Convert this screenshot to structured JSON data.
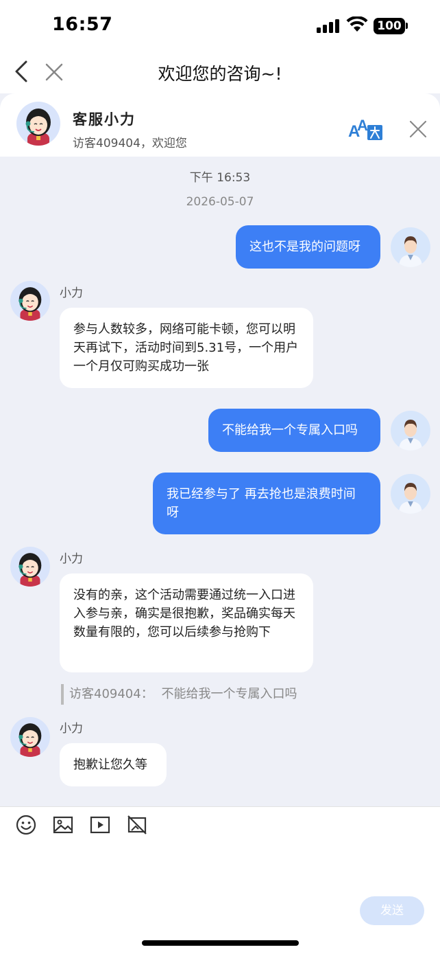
{
  "status_bar": {
    "time": "16:57",
    "battery": "100"
  },
  "nav": {
    "title": "欢迎您的咨询~!"
  },
  "agent": {
    "name": "客服小力",
    "subtitle": "访客409404，欢迎您"
  },
  "chat": {
    "time_label": "下午 16:53",
    "date_label": "2026-05-07",
    "messages": [
      {
        "from": "user",
        "text": "这也不是我的问题呀"
      },
      {
        "from": "agent",
        "sender": "小力",
        "text": "参与人数较多，网络可能卡顿，您可以明天再试下，活动时间到5.31号，一个用户一个月仅可购买成功一张"
      },
      {
        "from": "user",
        "text": "不能给我一个专属入口吗"
      },
      {
        "from": "user",
        "text": "我已经参与了 再去抢也是浪费时间呀"
      },
      {
        "from": "agent",
        "sender": "小力",
        "text": "没有的亲，这个活动需要通过统一入口进入参与亲，确实是很抱歉，奖品确实每天数量有限的，您可以后续参与抢购下"
      },
      {
        "from": "agent",
        "sender": "小力",
        "text": "抱歉让您久等",
        "quote_label": "访客409404：",
        "quote_text": "不能给我一个专属入口吗"
      }
    ]
  },
  "input": {
    "placeholder": "",
    "send_label": "发送"
  },
  "colors": {
    "user_bubble": "#3d7ff5",
    "chat_bg": "#eef0f7",
    "send_disabled": "#d6e4fb"
  },
  "icons": [
    "back-icon",
    "close-icon",
    "translate-icon",
    "emoji-icon",
    "image-icon",
    "video-icon",
    "no-image-icon"
  ]
}
